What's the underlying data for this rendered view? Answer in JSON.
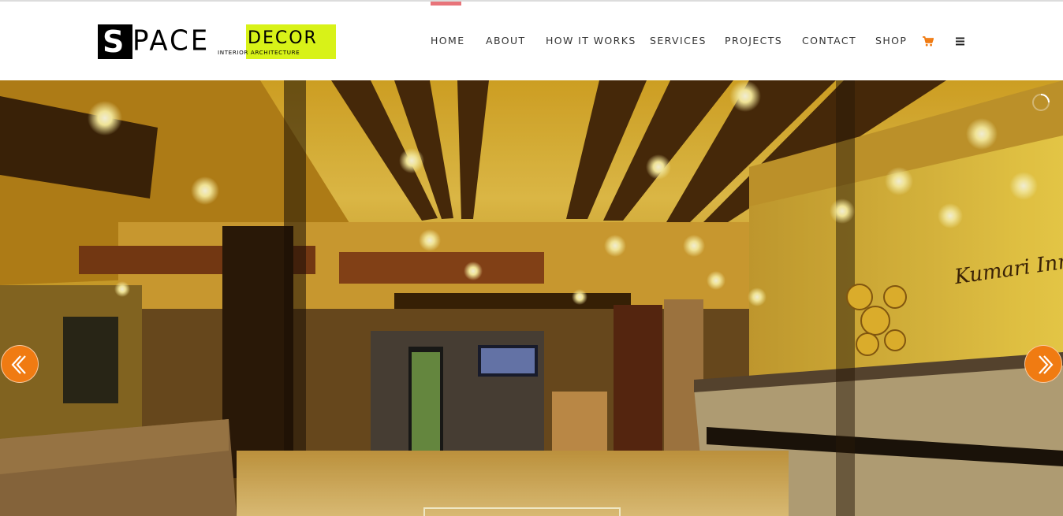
{
  "brand": {
    "logo_word_s": "S",
    "logo_word_pace": "PACE",
    "logo_word_decor": "DECOR",
    "logo_tagline": "INTERIOR ARCHITECTURE",
    "accent_color": "#d8f218"
  },
  "nav": {
    "items": [
      {
        "label": "HOME",
        "active": true
      },
      {
        "label": "ABOUT",
        "active": false
      },
      {
        "label": "HOW IT WORKS",
        "active": false
      },
      {
        "label": "SERVICES",
        "active": false
      },
      {
        "label": "PROJECTS",
        "active": false
      },
      {
        "label": "CONTACT",
        "active": false
      },
      {
        "label": "SHOP",
        "active": false
      }
    ],
    "cart_icon": "shopping-cart-icon",
    "menu_icon": "hamburger-menu-icon",
    "active_color": "#e8747a",
    "icon_color": "#f07b12"
  },
  "hero": {
    "sign_text": "Kumari Inn",
    "prev_icon": "chevron-left-icon",
    "next_icon": "chevron-right-icon",
    "arrow_color": "#f07b12",
    "loader_icon": "loading-spinner-icon"
  }
}
